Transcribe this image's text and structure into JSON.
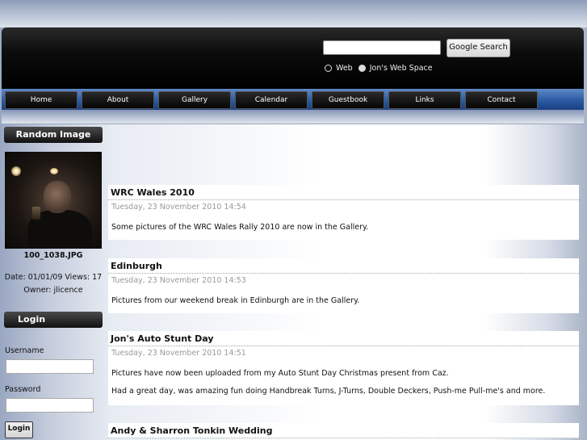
{
  "header": {
    "search": {
      "input_value": "",
      "button_label": "Google Search"
    },
    "radio_options": [
      {
        "label": "Web",
        "checked": false
      },
      {
        "label": "Jon's Web Space",
        "checked": true
      }
    ]
  },
  "nav": {
    "items": [
      "Home",
      "About",
      "Gallery",
      "Calendar",
      "Guestbook",
      "Links",
      "Contact"
    ]
  },
  "sidebar": {
    "random_image": {
      "title": "Random Image",
      "filename": "100_1038.JPG",
      "meta": "Date: 01/01/09 Views: 17",
      "owner": "Owner: jlicence"
    },
    "login": {
      "title": "Login",
      "username_label": "Username",
      "password_label": "Password",
      "button_label": "Login"
    }
  },
  "articles": [
    {
      "title": "WRC Wales 2010",
      "date": "Tuesday, 23 November 2010 14:54",
      "body": [
        "Some pictures of the WRC Wales Rally 2010 are now in the Gallery."
      ]
    },
    {
      "title": "Edinburgh",
      "date": "Tuesday, 23 November 2010 14:53",
      "body": [
        "Pictures from our weekend break in Edinburgh are in the Gallery."
      ]
    },
    {
      "title": "Jon's Auto Stunt Day",
      "date": "Tuesday, 23 November 2010 14:51",
      "body": [
        "Pictures have now been uploaded from my Auto Stunt Day Christmas present from Caz.",
        "Had a great day, was amazing fun doing Handbreak Turns, J-Turns, Double Deckers, Push-me Pull-me's and more."
      ]
    },
    {
      "title": "Andy & Sharron Tonkin Wedding",
      "date": "",
      "body": []
    }
  ]
}
